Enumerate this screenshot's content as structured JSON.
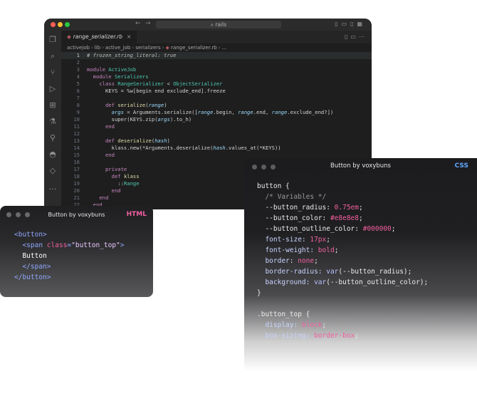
{
  "vscode": {
    "search": "rails",
    "tab": {
      "filename": "range_serializer.rb",
      "close": "×"
    },
    "breadcrumbs": [
      "activejob",
      "lib",
      "active_job",
      "serializers",
      "range_serializer.rb",
      "..."
    ],
    "lines": [
      {
        "n": "1",
        "parts": [
          [
            "cm",
            "# frozen_string_literal: true"
          ]
        ]
      },
      {
        "n": "2",
        "parts": []
      },
      {
        "n": "3",
        "parts": [
          [
            "k",
            "module "
          ],
          [
            "ty",
            "ActiveJob"
          ]
        ]
      },
      {
        "n": "4",
        "parts": [
          [
            "p",
            "  "
          ],
          [
            "k",
            "module "
          ],
          [
            "ty",
            "Serializers"
          ]
        ]
      },
      {
        "n": "5",
        "parts": [
          [
            "p",
            "    "
          ],
          [
            "k",
            "class "
          ],
          [
            "ty",
            "RangeSerializer"
          ],
          [
            "p",
            " < "
          ],
          [
            "ty",
            "ObjectSerializer"
          ]
        ]
      },
      {
        "n": "6",
        "parts": [
          [
            "p",
            "      KEYS = %w[begin end exclude_end].freeze"
          ]
        ]
      },
      {
        "n": "7",
        "parts": []
      },
      {
        "n": "8",
        "parts": [
          [
            "p",
            "      "
          ],
          [
            "k",
            "def "
          ],
          [
            "fn",
            "serialize"
          ],
          [
            "p",
            "("
          ],
          [
            "it",
            "range"
          ],
          [
            "p",
            ")"
          ]
        ]
      },
      {
        "n": "9",
        "parts": [
          [
            "p",
            "        "
          ],
          [
            "it",
            "args"
          ],
          [
            "p",
            " = Arguments.serialize(["
          ],
          [
            "it",
            "range"
          ],
          [
            "p",
            ".begin, "
          ],
          [
            "it",
            "range"
          ],
          [
            "p",
            ".end, "
          ],
          [
            "it",
            "range"
          ],
          [
            "p",
            ".exclude_end?])"
          ]
        ]
      },
      {
        "n": "10",
        "parts": [
          [
            "p",
            "        super(KEYS.zip("
          ],
          [
            "it",
            "args"
          ],
          [
            "p",
            ").to_h)"
          ]
        ]
      },
      {
        "n": "11",
        "parts": [
          [
            "p",
            "      "
          ],
          [
            "k",
            "end"
          ]
        ]
      },
      {
        "n": "12",
        "parts": []
      },
      {
        "n": "13",
        "parts": [
          [
            "p",
            "      "
          ],
          [
            "k",
            "def "
          ],
          [
            "fn",
            "deserialize"
          ],
          [
            "p",
            "("
          ],
          [
            "it",
            "hash"
          ],
          [
            "p",
            ")"
          ]
        ]
      },
      {
        "n": "14",
        "parts": [
          [
            "p",
            "        klass.new(*Arguments.deserialize("
          ],
          [
            "it",
            "hash"
          ],
          [
            "p",
            ".values_at(*KEYS))"
          ]
        ]
      },
      {
        "n": "15",
        "parts": [
          [
            "p",
            "      "
          ],
          [
            "k",
            "end"
          ]
        ]
      },
      {
        "n": "16",
        "parts": []
      },
      {
        "n": "17",
        "parts": [
          [
            "p",
            "      "
          ],
          [
            "k",
            "private"
          ]
        ]
      },
      {
        "n": "18",
        "parts": [
          [
            "p",
            "        "
          ],
          [
            "k",
            "def "
          ],
          [
            "fn",
            "klass"
          ]
        ]
      },
      {
        "n": "19",
        "parts": [
          [
            "p",
            "          ::"
          ],
          [
            "ty",
            "Range"
          ]
        ]
      },
      {
        "n": "20",
        "parts": [
          [
            "p",
            "        "
          ],
          [
            "k",
            "end"
          ]
        ]
      },
      {
        "n": "21",
        "parts": [
          [
            "p",
            "    "
          ],
          [
            "k",
            "end"
          ]
        ]
      },
      {
        "n": "22",
        "parts": [
          [
            "p",
            "  "
          ],
          [
            "k",
            "end"
          ]
        ]
      }
    ]
  },
  "css_window": {
    "title": "Button by voxybuns",
    "lang": "CSS",
    "lines": [
      [
        [
          "w",
          "button {"
        ]
      ],
      [
        [
          "c",
          "  /* Variables */"
        ]
      ],
      [
        [
          "w",
          "  --button_radius: "
        ],
        [
          "p",
          "0.75em"
        ],
        [
          "w",
          ";"
        ]
      ],
      [
        [
          "w",
          "  --button_color: "
        ],
        [
          "p",
          "#e8e8e8"
        ],
        [
          "w",
          ";"
        ]
      ],
      [
        [
          "w",
          "  --button_outline_color: "
        ],
        [
          "p",
          "#000000"
        ],
        [
          "w",
          ";"
        ]
      ],
      [
        [
          "v",
          "  font-size: "
        ],
        [
          "p",
          "17px"
        ],
        [
          "w",
          ";"
        ]
      ],
      [
        [
          "v",
          "  font-weight: "
        ],
        [
          "p",
          "bold"
        ],
        [
          "w",
          ";"
        ]
      ],
      [
        [
          "v",
          "  border: "
        ],
        [
          "p",
          "none"
        ],
        [
          "w",
          ";"
        ]
      ],
      [
        [
          "v",
          "  border-radius: "
        ],
        [
          "f",
          "var"
        ],
        [
          "w",
          "(--button_radius);"
        ]
      ],
      [
        [
          "v",
          "  background: "
        ],
        [
          "f",
          "var"
        ],
        [
          "w",
          "(--button_outline_color);"
        ]
      ],
      [
        [
          "w",
          "}"
        ]
      ],
      [],
      [
        [
          "w",
          ".button_top {"
        ]
      ],
      [
        [
          "v",
          "  display: "
        ],
        [
          "p",
          "block"
        ],
        [
          "w",
          ";"
        ]
      ],
      [
        [
          "v",
          "  box-sizing: "
        ],
        [
          "p",
          "border-box"
        ],
        [
          "w",
          ";"
        ]
      ]
    ]
  },
  "html_window": {
    "title": "Button by voxybuns",
    "lang": "HTML",
    "lines": [
      [
        [
          "tag",
          "<button>"
        ]
      ],
      [
        [
          "tx",
          "  "
        ],
        [
          "tag",
          "<span "
        ],
        [
          "at",
          "class"
        ],
        [
          "tag",
          "="
        ],
        [
          "st",
          "\"button_top\""
        ],
        [
          "tag",
          ">"
        ]
      ],
      [
        [
          "tx",
          "  Button"
        ]
      ],
      [
        [
          "tx",
          "  "
        ],
        [
          "tag",
          "</span>"
        ]
      ],
      [
        [
          "tag",
          "</button>"
        ]
      ]
    ]
  }
}
